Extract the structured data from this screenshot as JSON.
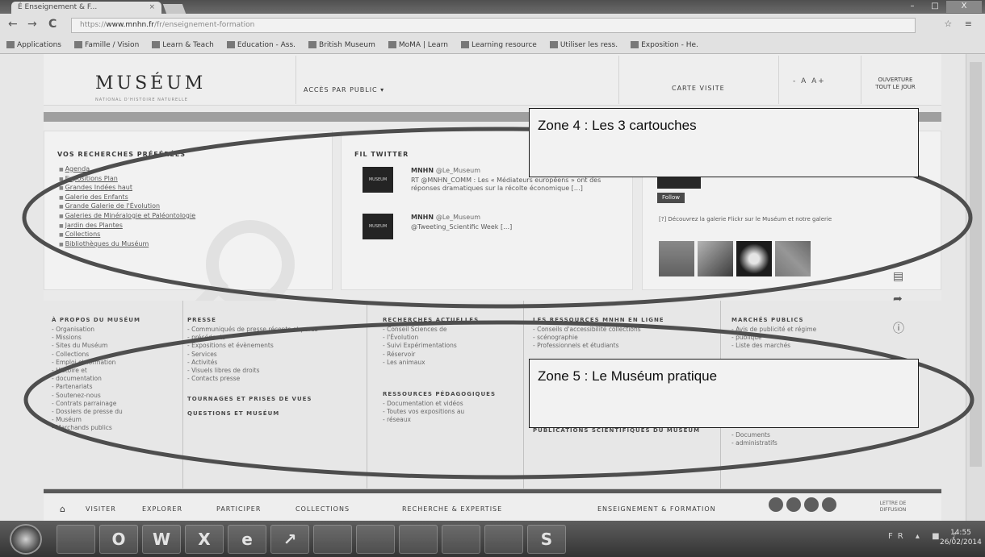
{
  "browser": {
    "tab_title": "É Enseignement & F...",
    "tab_close": "×",
    "url_prefix": "https://",
    "url_host": "www.mnhn.fr",
    "url_path": "/fr/enseignement-formation",
    "nav_back": "←",
    "nav_forward": "→",
    "nav_reload": "C",
    "right_icons": "☆ ≡",
    "window_buttons": [
      "–",
      "□",
      "X"
    ],
    "bookmarks": [
      "Applications",
      "Famille / Vision",
      "Learn & Teach",
      "Education - Ass.",
      "British Museum",
      "MoMA | Learn",
      "Learning resource",
      "Utiliser les ress.",
      "Exposition - He."
    ]
  },
  "museum": {
    "logo": "MUSÉUM",
    "logo_sub": "NATIONAL D'HISTOIRE NATURELLE",
    "acces": "ACCÈS PAR PUBLIC ▾",
    "carte": "CARTE VISITE",
    "fontsize": "- A A+",
    "fermeture": "OUVERTURE TOUT LE JOUR"
  },
  "cards": {
    "favorites": {
      "title": "VOS RECHERCHES PRÉFÉRÉES",
      "items": [
        "Agenda",
        "Expositions Plan",
        "Grandes Indées haut",
        "Galerie des Enfants",
        "Grande Galerie de l'Évolution",
        "Galeries de Minéralogie et Paléontologie",
        "Jardin des Plantes",
        "Collections",
        "Bibliothèques du Muséum"
      ]
    },
    "twitter": {
      "title": "FIL TWITTER",
      "tweets": [
        {
          "handle": "MNHN",
          "at": "@Le_Museum",
          "avatar": "MUSEUM",
          "text": "RT @MNHN_COMM : Les « Médiateurs européens » ont des réponses dramatiques sur la récolte économique […]"
        },
        {
          "handle": "MNHN",
          "at": "@Le_Museum",
          "avatar": "MUSEUM",
          "text": "@Tweeting_Scientific Week […]"
        }
      ]
    },
    "media": {
      "follow": "Follow",
      "caption": "[?] Découvrez la galerie Flickr sur le Muséum et notre galerie"
    }
  },
  "footer": {
    "columns": [
      {
        "heading": "À PROPOS DU MUSÉUM",
        "items": [
          "Organisation",
          "Missions",
          "Sites du Muséum",
          "Collections",
          "Emploi et formation",
          "Histoire et",
          "documentation",
          "Partenariats",
          "Soutenez-nous",
          "Contrats parrainage",
          "Dossiers de presse du",
          "Muséum",
          "Marchands publics"
        ],
        "subs": []
      },
      {
        "heading": "PRESSE",
        "items": [
          "Communiqués de presse récents et parus",
          "précédents",
          "Expositions et évènements",
          "Services",
          "Activités",
          "Visuels libres de droits",
          "Contacts presse"
        ],
        "subs": [
          "TOURNAGES ET PRISES DE VUES",
          "QUESTIONS ET MUSÉUM"
        ]
      },
      {
        "heading": "RECHERCHES ACTUELLES",
        "items": [
          "Conseil Sciences de",
          "l'Évolution",
          "Suivi Expérimentations",
          "Réservoir",
          "Les animaux"
        ],
        "subs": [
          "RESSOURCES PÉDAGOGIQUES"
        ],
        "subitems": [
          "Documentation et vidéos",
          "Toutes vos expositions au",
          "réseaux"
        ]
      },
      {
        "heading": "LES RESSOURCES MNHN EN LIGNE",
        "items": [
          "Conseils d'accessibilité collections",
          "scénographie",
          "Professionnels et étudiants"
        ],
        "subs": [
          "PUBLICATIONS SCIENTIFIQUES DU MUSÉUM"
        ]
      },
      {
        "heading": "MARCHÉS PUBLICS",
        "items": [
          "Avis de publicité et régime",
          "publique",
          "Liste des marchés"
        ],
        "tail": [
          "Documents",
          "administratifs"
        ]
      }
    ]
  },
  "bottom_nav": {
    "home": "⌂",
    "items": [
      "VISITER",
      "EXPLORER",
      "PARTICIPER",
      "COLLECTIONS",
      "RECHERCHE & EXPERTISE",
      "ENSEIGNEMENT & FORMATION"
    ],
    "lettre": "LETTRE DE DIFFUSION"
  },
  "taskbar": {
    "apps": [
      "",
      "O",
      "W",
      "X",
      "e",
      "↗",
      "",
      "",
      "",
      "",
      "",
      "S"
    ],
    "tray": "FR ▴ ■ ♪",
    "time": "14:55",
    "date": "26/02/2014"
  },
  "annotations": {
    "zone4": "Zone 4 : Les 3 cartouches",
    "zone5": "Zone 5 : Le Muséum pratique"
  }
}
